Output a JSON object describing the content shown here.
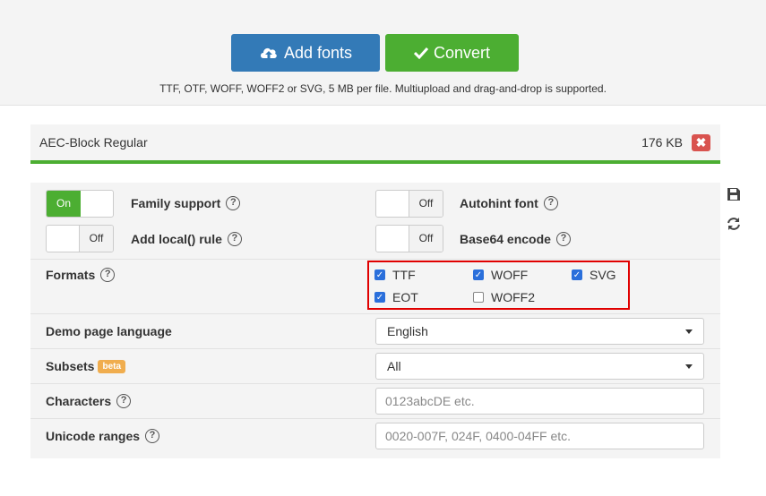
{
  "toolbar": {
    "add_fonts_label": "Add fonts",
    "convert_label": "Convert",
    "hint": "TTF, OTF, WOFF, WOFF2 or SVG, 5 MB per file. Multiupload and drag-and-drop is supported."
  },
  "file": {
    "name": "AEC-Block Regular",
    "size": "176 KB",
    "remove_icon": "✖",
    "progress": 1.0
  },
  "options": {
    "family_support": {
      "label": "Family support",
      "state": "On",
      "help": "?"
    },
    "add_local_rule": {
      "label": "Add local() rule",
      "state": "Off",
      "help": "?"
    },
    "autohint_font": {
      "label": "Autohint font",
      "state": "Off",
      "help": "?"
    },
    "base64_encode": {
      "label": "Base64 encode",
      "state": "Off",
      "help": "?"
    }
  },
  "formats": {
    "label": "Formats",
    "help": "?",
    "items": [
      {
        "label": "TTF",
        "checked": true
      },
      {
        "label": "WOFF",
        "checked": true
      },
      {
        "label": "SVG",
        "checked": true
      },
      {
        "label": "EOT",
        "checked": true
      },
      {
        "label": "WOFF2",
        "checked": false
      }
    ]
  },
  "demo_language": {
    "label": "Demo page language",
    "value": "English"
  },
  "subsets": {
    "label": "Subsets",
    "badge": "beta",
    "value": "All"
  },
  "characters": {
    "label": "Characters",
    "help": "?",
    "placeholder": "0123abcDE etc."
  },
  "unicode_ranges": {
    "label": "Unicode ranges",
    "help": "?",
    "placeholder": "0020-007F, 024F, 0400-04FF etc."
  },
  "side_icons": [
    "save-icon",
    "refresh-icon"
  ],
  "colors": {
    "primary": "#337ab7",
    "success": "#4cae32",
    "danger": "#d9534f",
    "highlight": "#e00000",
    "beta": "#f0ad4e"
  }
}
